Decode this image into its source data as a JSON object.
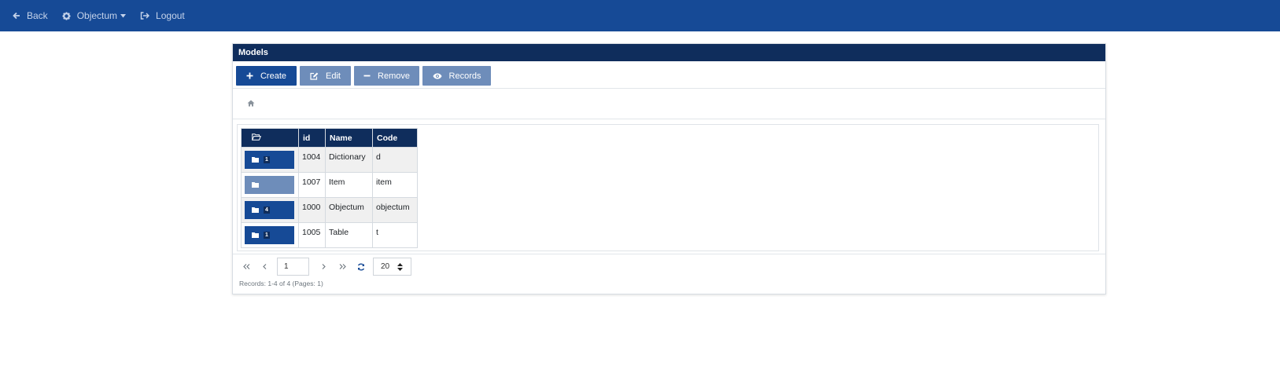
{
  "navbar": {
    "back_label": "Back",
    "objectum_label": "Objectum",
    "logout_label": "Logout"
  },
  "panel": {
    "title": "Models"
  },
  "actions": {
    "create_label": "Create",
    "edit_label": "Edit",
    "remove_label": "Remove",
    "records_label": "Records"
  },
  "table": {
    "columns": [
      "id",
      "Name",
      "Code"
    ],
    "rows": [
      {
        "count": "1",
        "id": "1004",
        "name": "Dictionary",
        "code": "d"
      },
      {
        "count": "",
        "id": "1007",
        "name": "Item",
        "code": "item"
      },
      {
        "count": "4",
        "id": "1000",
        "name": "Objectum",
        "code": "objectum"
      },
      {
        "count": "1",
        "id": "1005",
        "name": "Table",
        "code": "t"
      }
    ]
  },
  "pager": {
    "page": "1",
    "page_size": "20",
    "status": "Records: 1-4 of 4 (Pages: 1)"
  },
  "colors": {
    "navbar": "#164a96",
    "header": "#0f2d5c",
    "primary_button": "#164a96",
    "secondary_button": "#6e8dba"
  }
}
